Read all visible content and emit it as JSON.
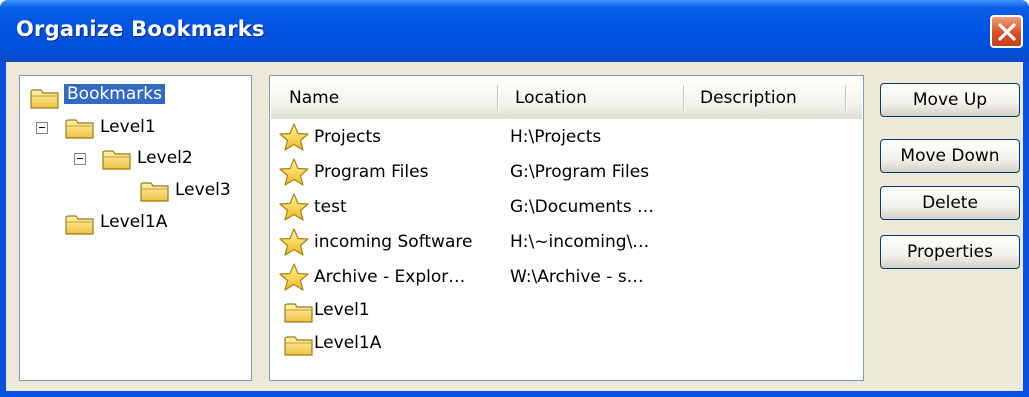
{
  "window": {
    "title": "Organize Bookmarks"
  },
  "tree": [
    {
      "label": "Bookmarks",
      "selected": true,
      "icon": "folder-icon"
    },
    {
      "label": "Level1",
      "expanded": true,
      "icon": "folder-icon"
    },
    {
      "label": "Level2",
      "expanded": true,
      "icon": "folder-icon"
    },
    {
      "label": "Level3",
      "icon": "folder-icon"
    },
    {
      "label": "Level1A",
      "icon": "folder-icon"
    }
  ],
  "list": {
    "columns": [
      "Name",
      "Location",
      "Description"
    ],
    "rows": [
      {
        "icon": "star-icon",
        "name": "Projects",
        "location": "H:\\Projects",
        "description": ""
      },
      {
        "icon": "star-icon",
        "name": "Program Files",
        "location": "G:\\Program Files",
        "description": ""
      },
      {
        "icon": "star-icon",
        "name": "test",
        "location": "G:\\Documents …",
        "description": ""
      },
      {
        "icon": "star-icon",
        "name": "incoming Software",
        "location": "H:\\~incoming\\…",
        "description": ""
      },
      {
        "icon": "star-icon",
        "name": "Archive - Explor…",
        "location": "W:\\Archive - s…",
        "description": ""
      },
      {
        "icon": "folder-icon",
        "name": "Level1",
        "location": "",
        "description": ""
      },
      {
        "icon": "folder-icon",
        "name": "Level1A",
        "location": "",
        "description": ""
      }
    ]
  },
  "buttons": {
    "move_up": "Move Up",
    "move_down": "Move Down",
    "delete": "Delete",
    "properties": "Properties"
  },
  "colors": {
    "titlebar": "#0054e3",
    "selection": "#316ac5",
    "dialog": "#ece9d8"
  }
}
